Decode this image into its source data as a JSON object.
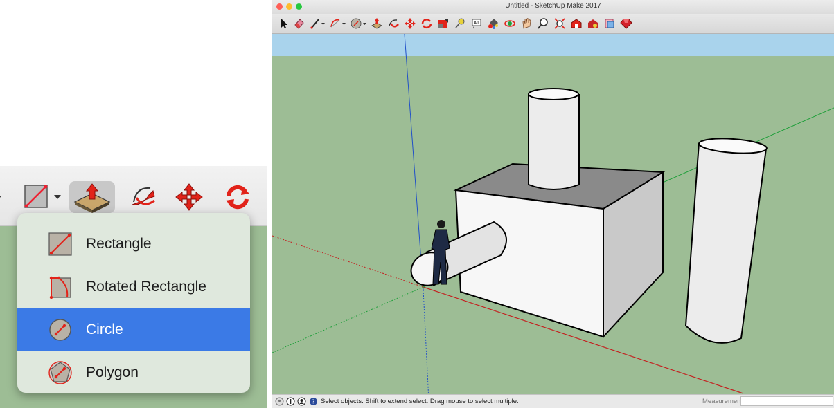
{
  "window": {
    "title": "Untitled - SketchUp Make 2017"
  },
  "shape_menu": {
    "items": [
      {
        "label": "Rectangle",
        "icon": "rectangle-icon",
        "selected": false
      },
      {
        "label": "Rotated Rectangle",
        "icon": "rotated-rectangle-icon",
        "selected": false
      },
      {
        "label": "Circle",
        "icon": "circle-icon",
        "selected": true
      },
      {
        "label": "Polygon",
        "icon": "polygon-icon",
        "selected": false
      }
    ]
  },
  "zoom_toolbar": {
    "icons": [
      "chevron-icon",
      "rectangle-tool-icon",
      "push-pull-icon",
      "follow-me-icon",
      "move-icon",
      "rotate-icon"
    ]
  },
  "main_toolbar": {
    "icons": [
      "select-icon",
      "eraser-icon",
      "line-icon",
      "arc-icon",
      "shapes-icon",
      "push-pull-icon",
      "offset-icon",
      "move-icon",
      "rotate-icon",
      "scale-icon",
      "tape-measure-icon",
      "text-icon",
      "paint-bucket-icon",
      "orbit-icon",
      "pan-icon",
      "zoom-icon",
      "zoom-extents-icon",
      "warehouse-icon",
      "extension-warehouse-icon",
      "layout-icon",
      "ruby-icon"
    ]
  },
  "status_bar": {
    "text": "Select objects. Shift to extend select. Drag mouse to select multiple.",
    "measurements_label": "Measurements",
    "measurements_value": ""
  },
  "colors": {
    "ground": "#9dbd95",
    "sky": "#a9d3ec",
    "selection": "#3b7ae6",
    "red_axis": "#c42020",
    "green_axis": "#1f9f3a",
    "blue_axis": "#2050c8"
  }
}
